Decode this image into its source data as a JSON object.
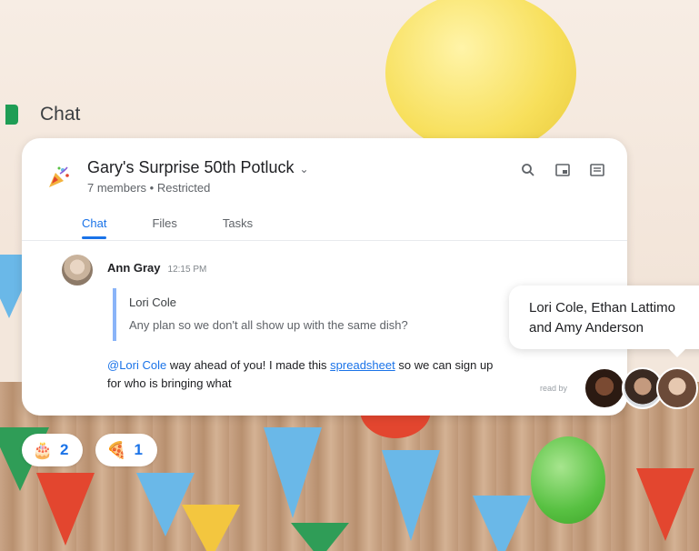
{
  "app": {
    "title": "Chat",
    "brand_color": "#1f9d55"
  },
  "room": {
    "name": "Gary's Surprise 50th Potluck",
    "members": "7 members",
    "separator": "•",
    "access": "Restricted",
    "icons": {
      "room": "party-popper-icon",
      "search": "search-icon",
      "pip": "picture-in-picture-icon",
      "threads": "threads-icon"
    }
  },
  "tabs": [
    {
      "label": "Chat",
      "active": true
    },
    {
      "label": "Files",
      "active": false
    },
    {
      "label": "Tasks",
      "active": false
    }
  ],
  "message": {
    "author": "Ann Gray",
    "time": "12:15 PM",
    "quote": {
      "author": "Lori Cole",
      "text": "Any plan so we don't all show up with the same dish?"
    },
    "mention": "@Lori Cole",
    "text_a": " way ahead of you! I made this ",
    "link": "spreadsheet",
    "text_b": " so we can sign up for who is bringing what",
    "read_by_label": "read by"
  },
  "tooltip": {
    "line1": "Lori Cole, Ethan Lattimo",
    "line2": "and Amy Anderson"
  },
  "reactions": [
    {
      "emoji": "🎂",
      "icon": "birthday-cake-icon",
      "count": "2"
    },
    {
      "emoji": "🍕",
      "icon": "pizza-icon",
      "count": "1"
    }
  ],
  "colors": {
    "accent": "#1a73e8",
    "quote_bar": "#8ab4f8"
  }
}
